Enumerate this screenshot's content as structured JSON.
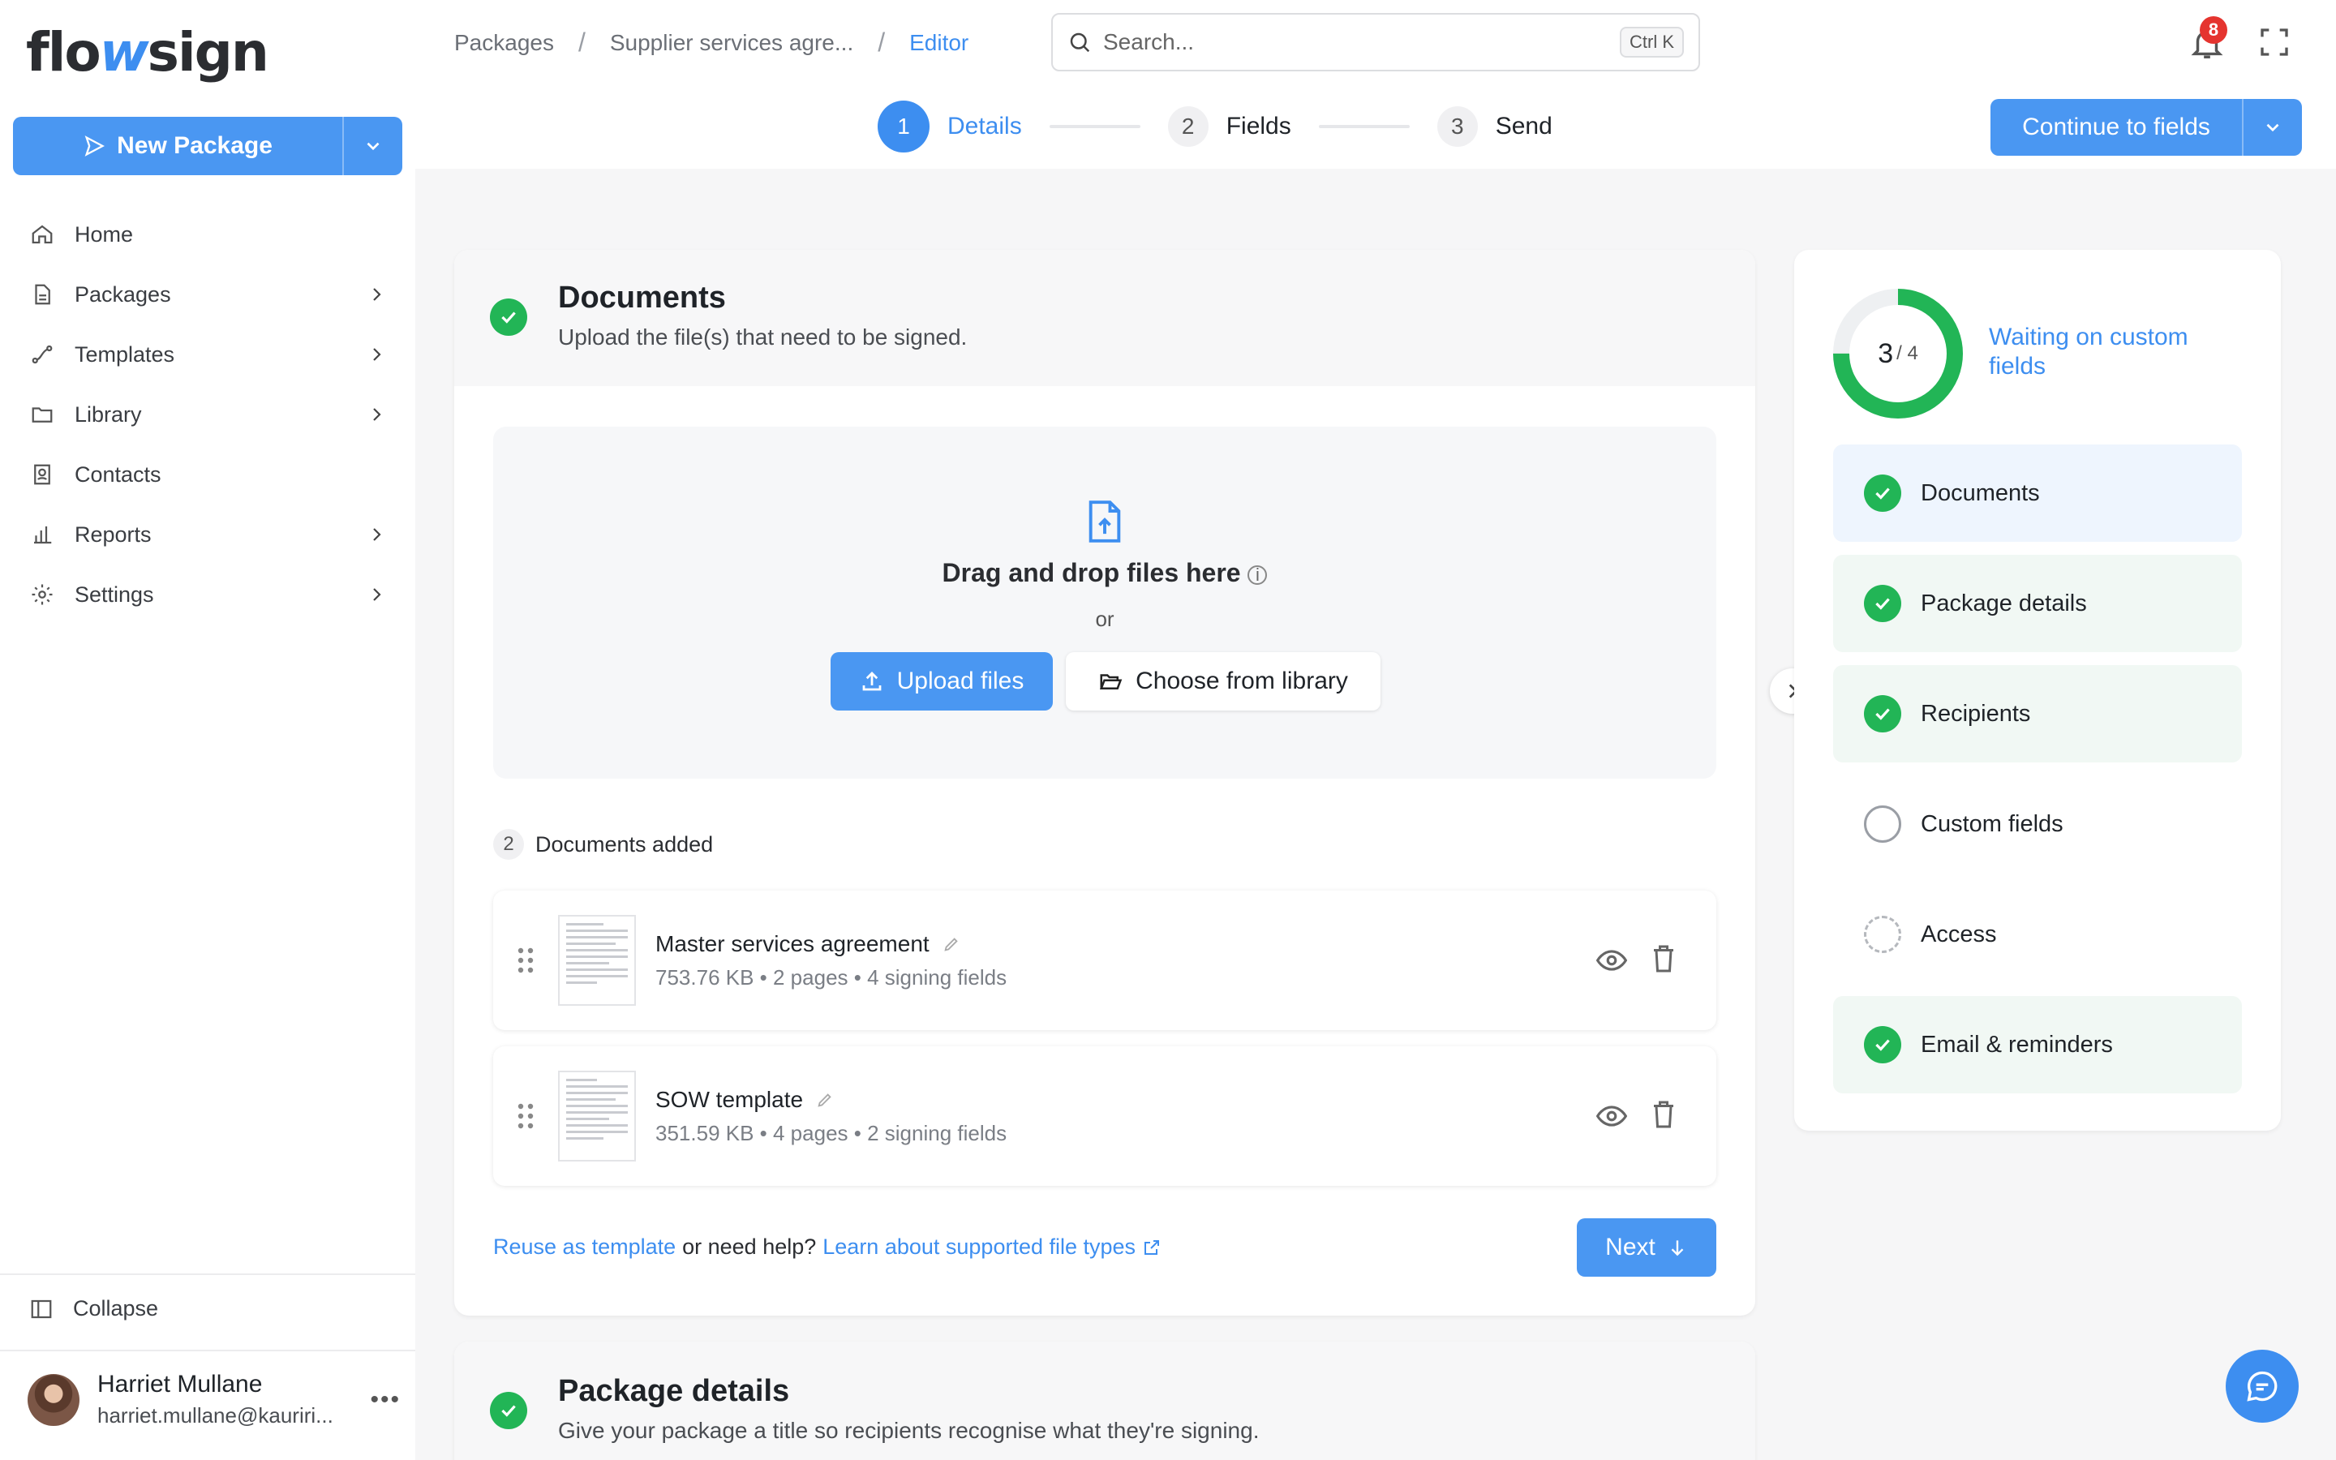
{
  "app": {
    "logo_pre": "flo",
    "logo_w": "w",
    "logo_post": "sign"
  },
  "sidebar": {
    "new_package": "New Package",
    "items": [
      {
        "label": "Home",
        "icon": "home-icon",
        "has_children": false
      },
      {
        "label": "Packages",
        "icon": "file-icon",
        "has_children": true
      },
      {
        "label": "Templates",
        "icon": "template-icon",
        "has_children": true
      },
      {
        "label": "Library",
        "icon": "folder-icon",
        "has_children": true
      },
      {
        "label": "Contacts",
        "icon": "contacts-icon",
        "has_children": false
      },
      {
        "label": "Reports",
        "icon": "chart-icon",
        "has_children": true
      },
      {
        "label": "Settings",
        "icon": "gear-icon",
        "has_children": true
      }
    ],
    "collapse_label": "Collapse",
    "user": {
      "name": "Harriet Mullane",
      "email": "harriet.mullane@kauriri..."
    }
  },
  "header": {
    "breadcrumbs": [
      "Packages",
      "Supplier services agre...",
      "Editor"
    ],
    "search_placeholder": "Search...",
    "search_shortcut": "Ctrl K",
    "notification_count": "8",
    "steps": [
      {
        "num": "1",
        "label": "Details",
        "active": true
      },
      {
        "num": "2",
        "label": "Fields",
        "active": false
      },
      {
        "num": "3",
        "label": "Send",
        "active": false
      }
    ],
    "continue_label": "Continue to fields"
  },
  "documents": {
    "title": "Documents",
    "subtitle": "Upload the file(s) that need to be signed.",
    "drop_title": "Drag and drop files here",
    "or": "or",
    "upload_label": "Upload files",
    "library_label": "Choose from library",
    "added_count": "2",
    "added_label": "Documents added",
    "files": [
      {
        "name": "Master services agreement",
        "size": "753.76 KB",
        "pages": "2 pages",
        "fields": "4 signing fields"
      },
      {
        "name": "SOW template",
        "size": "351.59 KB",
        "pages": "4 pages",
        "fields": "2 signing fields"
      }
    ],
    "footer_link1": "Reuse as template",
    "footer_mid": "or need help?",
    "footer_link2": "Learn about supported file types",
    "next_label": "Next"
  },
  "package_details": {
    "title": "Package details",
    "subtitle": "Give your package a title so recipients recognise what they're signing."
  },
  "progress": {
    "done": "3",
    "total": "/ 4",
    "fraction": 0.75,
    "status": "Waiting on custom fields",
    "items": [
      {
        "label": "Documents",
        "state": "done",
        "style": "blue"
      },
      {
        "label": "Package details",
        "state": "done",
        "style": "green"
      },
      {
        "label": "Recipients",
        "state": "done",
        "style": "green"
      },
      {
        "label": "Custom fields",
        "state": "empty",
        "style": "none"
      },
      {
        "label": "Access",
        "state": "pending",
        "style": "none"
      },
      {
        "label": "Email & reminders",
        "state": "done",
        "style": "green"
      }
    ]
  },
  "colors": {
    "accent": "#3d8ef0",
    "success": "#22b556",
    "badge": "#e5342f"
  }
}
